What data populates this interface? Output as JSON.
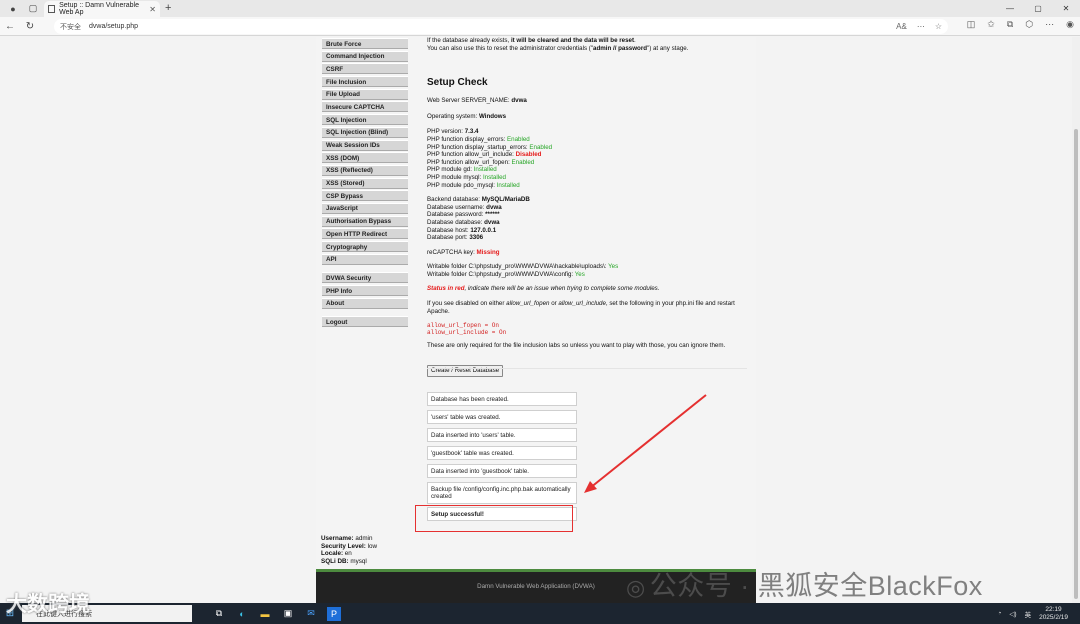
{
  "browser": {
    "tab_title": "Setup :: Damn Vulnerable Web Ap",
    "url_warning": "不安全",
    "url": "dvwa/setup.php",
    "zoom": "A&"
  },
  "sidebar": {
    "items": [
      "Brute Force",
      "Command Injection",
      "CSRF",
      "File Inclusion",
      "File Upload",
      "Insecure CAPTCHA",
      "SQL Injection",
      "SQL Injection (Blind)",
      "Weak Session IDs",
      "XSS (DOM)",
      "XSS (Reflected)",
      "XSS (Stored)",
      "CSP Bypass",
      "JavaScript",
      "Authorisation Bypass",
      "Open HTTP Redirect",
      "Cryptography",
      "API"
    ],
    "items2": [
      "DVWA Security",
      "PHP Info",
      "About"
    ],
    "logout": "Logout"
  },
  "intro": {
    "line1_a": "If the database already exists, ",
    "line1_b": "it will be cleared and the data will be reset",
    "line1_c": ".",
    "line2_a": "You can also use this to reset the administrator credentials (\"",
    "line2_b": "admin // password",
    "line2_c": "\") at any stage."
  },
  "setup_check": {
    "title": "Setup Check",
    "server_name_label": "Web Server SERVER_NAME: ",
    "server_name": "dvwa",
    "os_label": "Operating system: ",
    "os": "Windows",
    "php_version_label": "PHP version: ",
    "php_version": "7.3.4",
    "php_checks": [
      {
        "label": "PHP function display_errors: ",
        "value": "Enabled",
        "status": "green"
      },
      {
        "label": "PHP function display_startup_errors: ",
        "value": "Enabled",
        "status": "green"
      },
      {
        "label": "PHP function allow_url_include: ",
        "value": "Disabled",
        "status": "red"
      },
      {
        "label": "PHP function allow_url_fopen: ",
        "value": "Enabled",
        "status": "green"
      },
      {
        "label": "PHP module gd: ",
        "value": "Installed",
        "status": "green"
      },
      {
        "label": "PHP module mysql: ",
        "value": "Installed",
        "status": "green"
      },
      {
        "label": "PHP module pdo_mysql: ",
        "value": "Installed",
        "status": "green"
      }
    ],
    "backend_label": "Backend database: ",
    "backend": "MySQL/MariaDB",
    "db_user_label": "Database username: ",
    "db_user": "dvwa",
    "db_pass_label": "Database password: ",
    "db_pass": "******",
    "db_name_label": "Database database: ",
    "db_name": "dvwa",
    "db_host_label": "Database host: ",
    "db_host": "127.0.0.1",
    "db_port_label": "Database port: ",
    "db_port": "3306",
    "recaptcha_label": "reCAPTCHA key: ",
    "recaptcha": "Missing",
    "folder1_label": "Writable folder C:\\phpstudy_pro\\WWW\\DVWA\\hackable\\uploads\\: ",
    "folder1": "Yes",
    "folder2_label": "Writable folder C:\\phpstudy_pro\\WWW\\DVWA\\config: ",
    "folder2": "Yes",
    "status_red": "Status in red",
    "status_note": ", indicate there will be an issue when trying to complete some modules.",
    "disabled_note_a": "If you see disabled on either ",
    "disabled_note_b": "allow_url_fopen",
    "disabled_note_c": " or ",
    "disabled_note_d": "allow_url_include",
    "disabled_note_e": ", set the following in your php.ini file and restart Apache.",
    "code1": "allow_url_fopen = On",
    "code2": "allow_url_include = On",
    "only_required": "These are only required for the file inclusion labs so unless you want to play with those, you can ignore them.",
    "button": "Create / Reset Database"
  },
  "messages": [
    "Database has been created.",
    "'users' table was created.",
    "Data inserted into 'users' table.",
    "'guestbook' table was created.",
    "Data inserted into 'guestbook' table.",
    "Backup file /config/config.inc.php.bak automatically created"
  ],
  "success": "Setup successful!",
  "user_info": {
    "username_label": "Username: ",
    "username": "admin",
    "security_label": "Security Level: ",
    "security": "low",
    "locale_label": "Locale: ",
    "locale": "en",
    "sqli_label": "SQLi DB: ",
    "sqli": "mysql"
  },
  "footer": "Damn Vulnerable Web Application (DVWA)",
  "watermark": "公众号 · 黑狐安全BlackFox",
  "bottom_watermark": "大数跨境",
  "taskbar": {
    "search_placeholder": "在此键入进行搜索",
    "ime": "英",
    "time": "22:19",
    "date": "2025/2/19"
  },
  "accent_colors": {
    "red": "#e53030",
    "green": "#25a525",
    "footer_bar": "#4d8b3f"
  }
}
